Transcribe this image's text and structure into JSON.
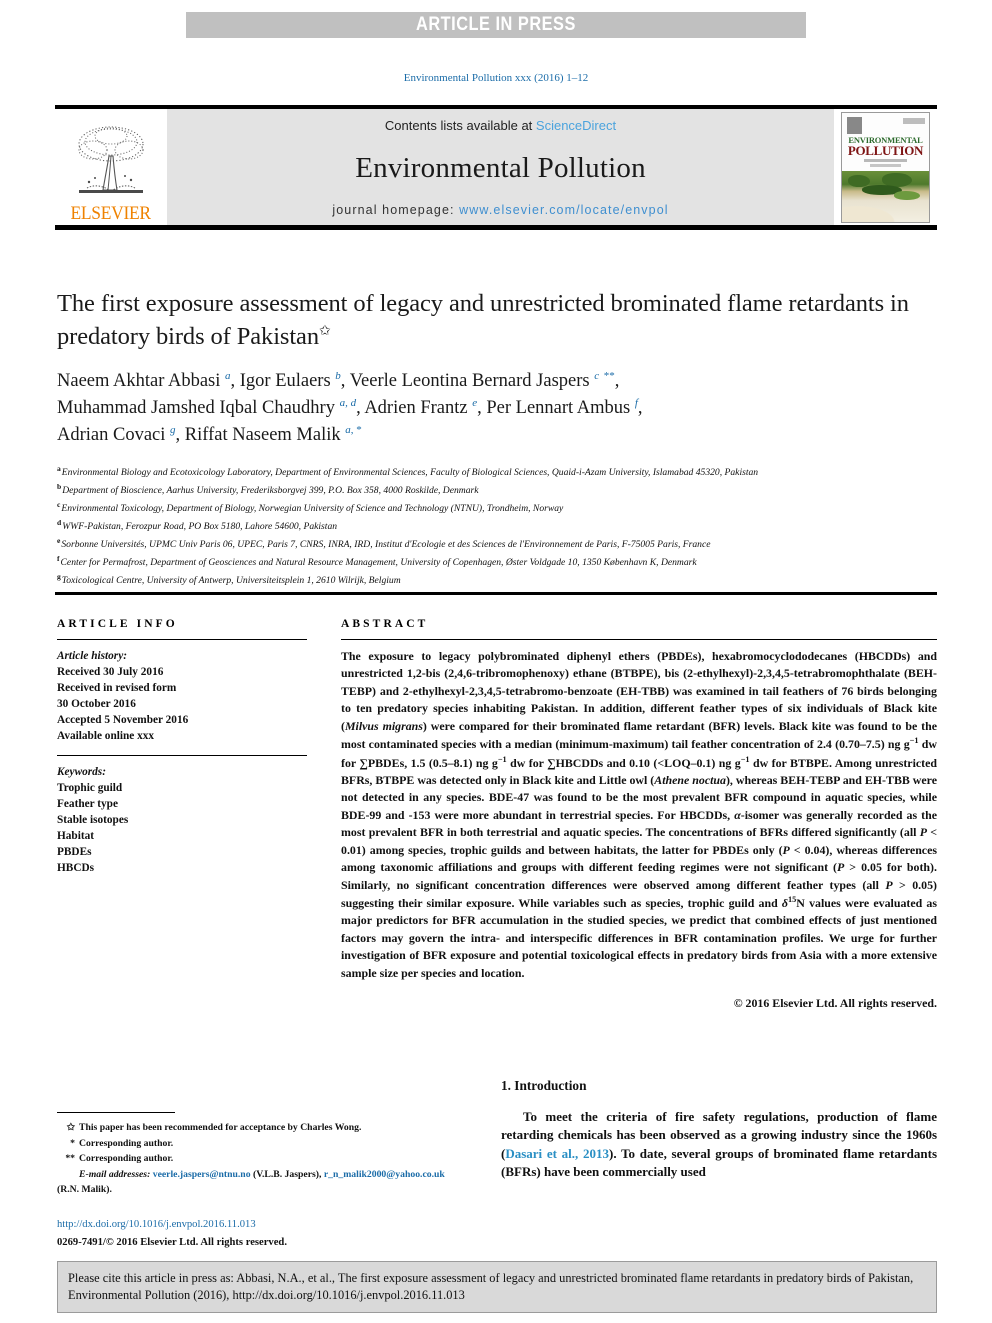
{
  "banner": {
    "text": "ARTICLE IN PRESS"
  },
  "journal_ref": "Environmental Pollution xxx (2016) 1–12",
  "masthead": {
    "contents_prefix": "Contents lists available at ",
    "contents_link": "ScienceDirect",
    "journal_title": "Environmental Pollution",
    "homepage_prefix": "journal homepage: ",
    "homepage_url": "www.elsevier.com/locate/envpol",
    "publisher_name": "ELSEVIER",
    "cover": {
      "line1": "ENVIRONMENTAL",
      "line2": "POLLUTION"
    }
  },
  "article": {
    "title": "The first exposure assessment of legacy and unrestricted brominated flame retardants in predatory birds of Pakistan",
    "title_marker": "✩",
    "authors_html": "Naeem Akhtar Abbasi <sup>a</sup>, Igor Eulaers <sup>b</sup>, Veerle Leontina Bernard Jaspers <sup>c</sup> <sup class=\"plain\">**</sup>,<br>Muhammad Jamshed Iqbal Chaudhry <sup>a, d</sup>, Adrien Frantz <sup>e</sup>, Per Lennart Ambus <sup>f</sup>,<br>Adrian Covaci <sup>g</sup>, Riffat Naseem Malik <sup>a</sup><sup class=\"plain\">, *</sup>",
    "affiliations": [
      {
        "mark": "a",
        "text": "Environmental Biology and Ecotoxicology Laboratory, Department of Environmental Sciences, Faculty of Biological Sciences, Quaid-i-Azam University, Islamabad 45320, Pakistan"
      },
      {
        "mark": "b",
        "text": "Department of Bioscience, Aarhus University, Frederiksborgvej 399, P.O. Box 358, 4000 Roskilde, Denmark"
      },
      {
        "mark": "c",
        "text": "Environmental Toxicology, Department of Biology, Norwegian University of Science and Technology (NTNU), Trondheim, Norway"
      },
      {
        "mark": "d",
        "text": "WWF-Pakistan, Ferozpur Road, PO Box 5180, Lahore 54600, Pakistan"
      },
      {
        "mark": "e",
        "text": "Sorbonne Universités, UPMC Univ Paris 06, UPEC, Paris 7, CNRS, INRA, IRD, Institut d'Ecologie et des Sciences de l'Environnement de Paris, F-75005 Paris, France"
      },
      {
        "mark": "f",
        "text": "Center for Permafrost, Department of Geosciences and Natural Resource Management, University of Copenhagen, Øster Voldgade 10, 1350 København K, Denmark"
      },
      {
        "mark": "g",
        "text": "Toxicological Centre, University of Antwerp, Universiteitsplein 1, 2610 Wilrijk, Belgium"
      }
    ]
  },
  "article_info": {
    "heading": "ARTICLE INFO",
    "history_label": "Article history:",
    "history": [
      "Received 30 July 2016",
      "Received in revised form",
      "30 October 2016",
      "Accepted 5 November 2016",
      "Available online xxx"
    ],
    "keywords_label": "Keywords:",
    "keywords": [
      "Trophic guild",
      "Feather type",
      "Stable isotopes",
      "Habitat",
      "PBDEs",
      "HBCDs"
    ]
  },
  "abstract": {
    "heading": "ABSTRACT",
    "body_html": "The exposure to legacy polybrominated diphenyl ethers (PBDEs), hexabromocyclododecanes (HBCDDs) and unrestricted 1,2-bis (2,4,6-tribromophenoxy) ethane (BTBPE), bis (2-ethylhexyl)-2,3,4,5-tetrabromophthalate (BEH-TEBP) and 2-ethylhexyl-2,3,4,5-tetrabromo-benzoate (EH-TBB) was examined in tail feathers of 76 birds belonging to ten predatory species inhabiting Pakistan. In addition, different feather types of six individuals of Black kite (<i>Milvus migrans</i>) were compared for their brominated flame retardant (BFR) levels. Black kite was found to be the most contaminated species with a median (minimum-maximum) tail feather concentration of 2.4 (0.70–7.5) ng g<sup>−1</sup> dw for ∑PBDEs, 1.5 (0.5–8.1) ng g<sup>−1</sup> dw for ∑HBCDDs and 0.10 (&lt;LOQ–0.1) ng g<sup>−1</sup> dw for BTBPE. Among unrestricted BFRs, BTBPE was detected only in Black kite and Little owl (<i>Athene noctua</i>), whereas BEH-TEBP and EH-TBB were not detected in any species. BDE-47 was found to be the most prevalent BFR compound in aquatic species, while BDE-99 and -153 were more abundant in terrestrial species. For HBCDDs, <i>α</i>-isomer was generally recorded as the most prevalent BFR in both terrestrial and aquatic species. The concentrations of BFRs differed significantly (all <i>P</i> &lt; 0.01) among species, trophic guilds and between habitats, the latter for PBDEs only (<i>P</i> &lt; 0.04), whereas differences among taxonomic affiliations and groups with different feeding regimes were not significant (<i>P</i> &gt; 0.05 for both). Similarly, no significant concentration differences were observed among different feather types (all <i>P</i> &gt; 0.05) suggesting their similar exposure. While variables such as species, trophic guild and <i>δ</i><sup>15</sup>N values were evaluated as major predictors for BFR accumulation in the studied species, we predict that combined effects of just mentioned factors may govern the intra- and interspecific differences in BFR contamination profiles. We urge for further investigation of BFR exposure and potential toxicological effects in predatory birds from Asia with a more extensive sample size per species and location.",
    "copyright": "© 2016 Elsevier Ltd. All rights reserved."
  },
  "footnotes": {
    "items": [
      {
        "mark": "✩",
        "text": "This paper has been recommended for acceptance by Charles Wong."
      },
      {
        "mark": "*",
        "text": "Corresponding author."
      },
      {
        "mark": "**",
        "text": "Corresponding author."
      }
    ],
    "email_label": "E-mail addresses:",
    "email_1": "veerle.jaspers@ntnu.no",
    "email_1_owner": "(V.L.B. Jaspers),",
    "email_2": "r_n_malik2000@yahoo.co.uk",
    "email_2_owner": "(R.N. Malik)."
  },
  "doi": {
    "url": "http://dx.doi.org/10.1016/j.envpol.2016.11.013",
    "issn_line": "0269-7491/© 2016 Elsevier Ltd. All rights reserved."
  },
  "introduction": {
    "heading": "1. Introduction",
    "paragraph_prefix": "To meet the criteria of fire safety regulations, production of flame retarding chemicals has been observed as a growing industry since the 1960s (",
    "citation": "Dasari et al., 2013",
    "paragraph_suffix": "). To date, several groups of brominated flame retardants (BFRs) have been commercially used"
  },
  "citation_box": {
    "text": "Please cite this article in press as: Abbasi, N.A., et al., The first exposure assessment of legacy and unrestricted brominated flame retardants in predatory birds of Pakistan, Environmental Pollution (2016), http://dx.doi.org/10.1016/j.envpol.2016.11.013"
  },
  "colors": {
    "link_blue": "#1b6ca8",
    "elsevier_orange": "#ef8200",
    "banner_gray": "#c0c0c0",
    "masthead_gray": "#e3e3e3"
  }
}
